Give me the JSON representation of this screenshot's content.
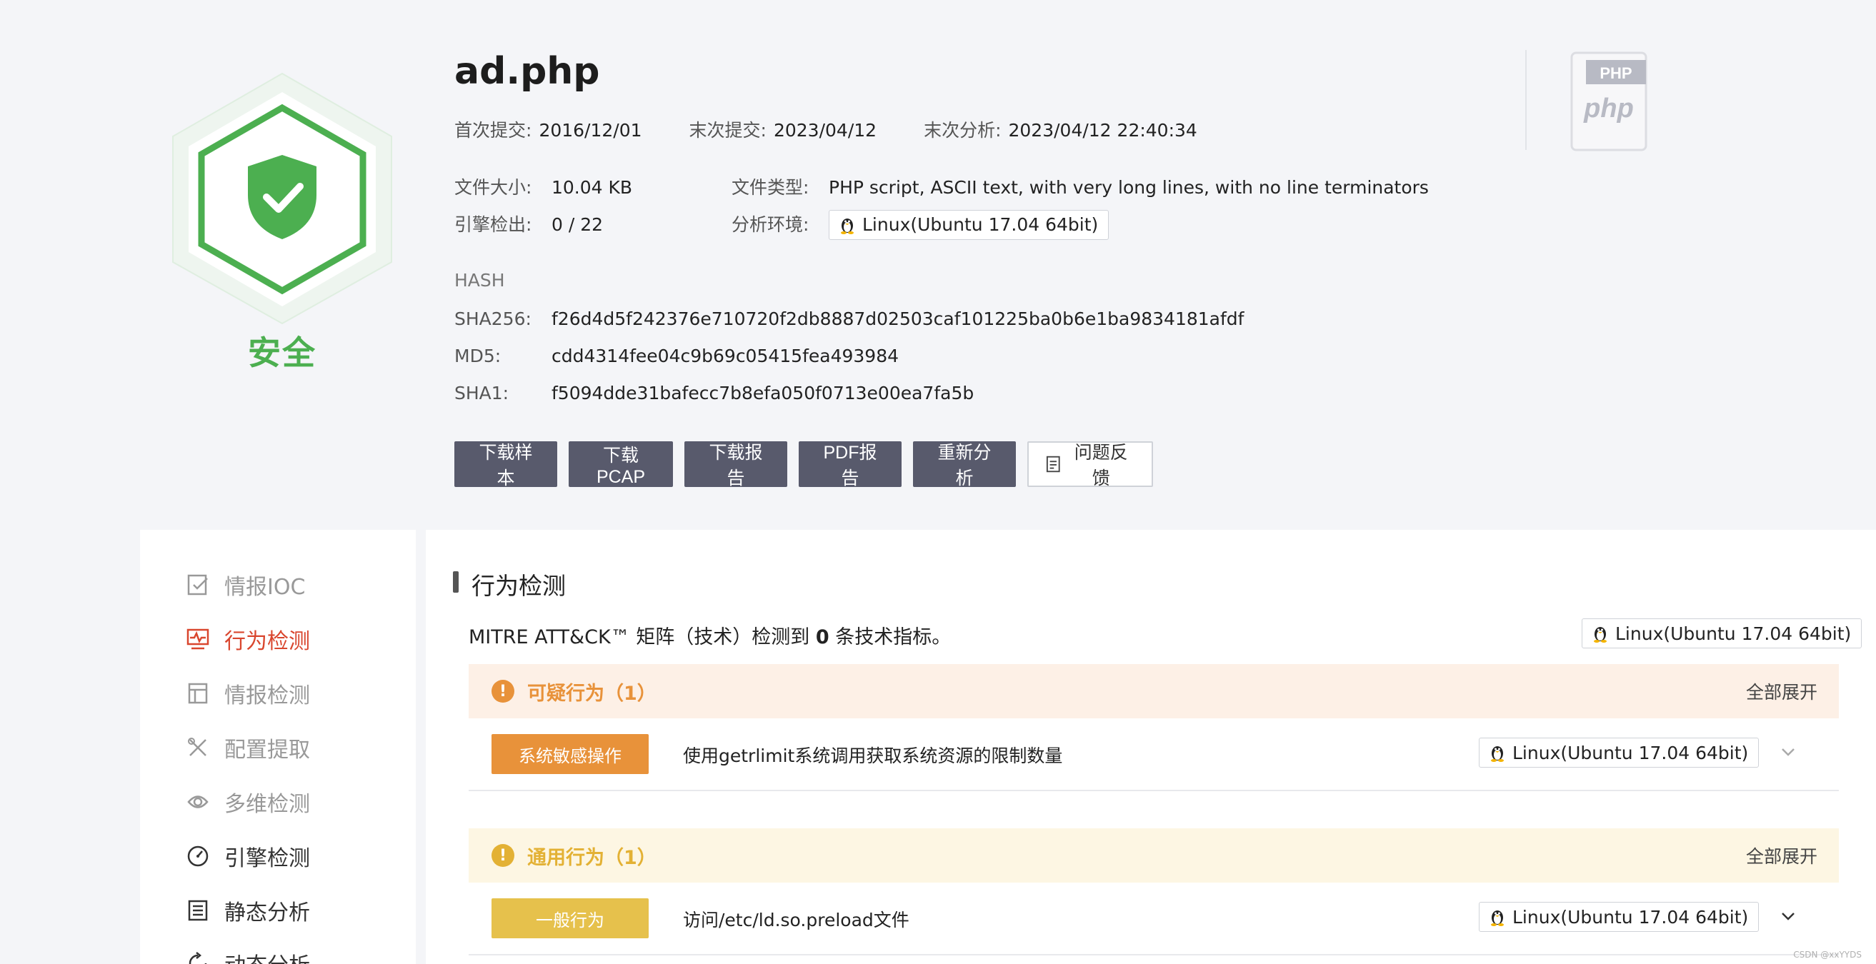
{
  "file": {
    "name": "ad.php",
    "verdict": "安全",
    "first_submit_label": "首次提交:",
    "first_submit": "2016/12/01",
    "last_submit_label": "末次提交:",
    "last_submit": "2023/04/12",
    "last_analysis_label": "末次分析:",
    "last_analysis": "2023/04/12 22:40:34",
    "size_label": "文件大小:",
    "size": "10.04 KB",
    "type_label": "文件类型:",
    "type": "PHP script, ASCII text, with very long lines, with no line terminators",
    "engine_label": "引擎检出:",
    "engine": "0 / 22",
    "env_label": "分析环境:",
    "env": "Linux(Ubuntu 17.04 64bit)",
    "php_badge": "PHP",
    "php_logo": "php"
  },
  "hash": {
    "title": "HASH",
    "sha256_label": "SHA256:",
    "sha256": "f26d4d5f242376e710720f2db8887d02503caf101225ba0b6e1ba9834181afdf",
    "md5_label": "MD5:",
    "md5": "cdd4314fee04c9b69c05415fea493984",
    "sha1_label": "SHA1:",
    "sha1": "f5094dde31bafecc7b8efa050f0713e00ea7fa5b"
  },
  "buttons": {
    "download_sample": "下载样本",
    "download_pcap": "下载PCAP",
    "download_report": "下载报告",
    "pdf_report": "PDF报告",
    "reanalyze": "重新分析",
    "feedback": "问题反馈"
  },
  "sidebar": {
    "items": [
      {
        "label": "情报IOC",
        "icon": "edit-check-icon"
      },
      {
        "label": "行为检测",
        "icon": "monitor-pulse-icon"
      },
      {
        "label": "情报检测",
        "icon": "layout-icon"
      },
      {
        "label": "配置提取",
        "icon": "tools-icon"
      },
      {
        "label": "多维检测",
        "icon": "multi-scan-icon"
      },
      {
        "label": "引擎检测",
        "icon": "gauge-icon"
      },
      {
        "label": "静态分析",
        "icon": "list-icon"
      },
      {
        "label": "动态分析",
        "icon": "refresh-icon"
      }
    ]
  },
  "behavior": {
    "section_title": "行为检测",
    "mitre_prefix": "MITRE ATT&CK™ 矩阵（技术）检测到 ",
    "mitre_count": "0",
    "mitre_suffix": " 条技术指标。",
    "env": "Linux(Ubuntu 17.04 64bit)",
    "expand_all": "全部展开",
    "groups": [
      {
        "title": "可疑行为（1）",
        "tag": "系统敏感操作",
        "text": "使用getrlimit系统调用获取系统资源的限制数量",
        "env": "Linux(Ubuntu 17.04 64bit)",
        "color": "#e8923a"
      },
      {
        "title": "通用行为（1）",
        "tag": "一般行为",
        "text": "访问/etc/ld.so.preload文件",
        "env": "Linux(Ubuntu 17.04 64bit)",
        "color": "#e3b134"
      }
    ]
  },
  "colors": {
    "safe": "#4caf50",
    "active": "#d9462e",
    "button": "#585a6c"
  },
  "watermark": "CSDN @xxYYDS"
}
